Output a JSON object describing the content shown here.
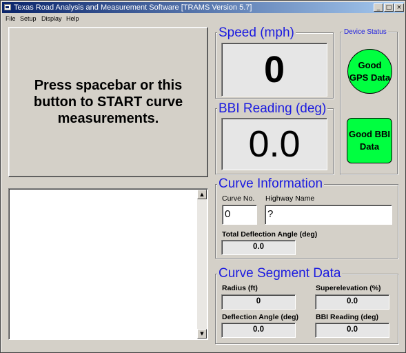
{
  "window": {
    "title": "Texas Road Analysis and Measurement Software [TRAMS Version 5.7]",
    "controls": {
      "minimize": "_",
      "maximize": "□",
      "close": "×"
    }
  },
  "menu": {
    "items": [
      "File",
      "Setup",
      "Display",
      "Help"
    ]
  },
  "start_button": {
    "label": "Press spacebar or this button to START curve measurements."
  },
  "speed": {
    "legend": "Speed (mph)",
    "value": "0"
  },
  "bbi": {
    "legend": "BBI Reading (deg)",
    "value": "0.0"
  },
  "device_status": {
    "legend": "Device Status",
    "gps_label": "Good GPS Data",
    "bbi_label": "Good BBI Data",
    "indicator_color": "#00ff40"
  },
  "curve_info": {
    "legend": "Curve Information",
    "curve_no_label": "Curve No.",
    "curve_no_value": "0",
    "highway_label": "Highway Name",
    "highway_value": "?",
    "total_deflection_label": "Total Deflection Angle (deg)",
    "total_deflection_value": "0.0"
  },
  "segment": {
    "legend": "Curve Segment Data",
    "radius_label": "Radius (ft)",
    "radius_value": "0",
    "superelevation_label": "Superelevation (%)",
    "superelevation_value": "0.0",
    "deflection_label": "Deflection Angle (deg)",
    "deflection_value": "0.0",
    "bbi_label": "BBI Reading (deg)",
    "bbi_value": "0.0"
  },
  "colors": {
    "legend_blue": "#1a1ae0",
    "titlebar": "#0a246a"
  }
}
